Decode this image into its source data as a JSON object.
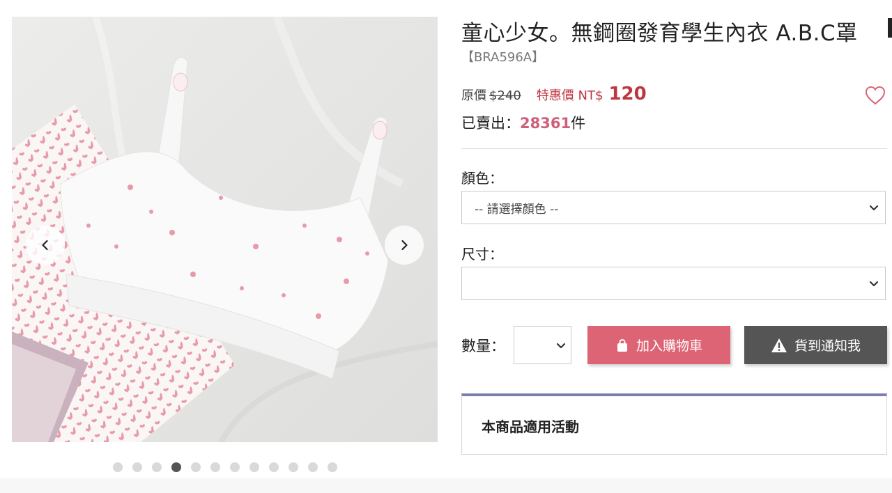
{
  "gallery": {
    "prev_icon": "chevron-left-icon",
    "next_icon": "chevron-right-icon",
    "dot_count": 12,
    "active_dot": 4,
    "accent_pink": "#e79aa8"
  },
  "product": {
    "title": "童心少女。無鋼圈發育學生內衣 A.B.C罩",
    "sku": "【BRA596A】",
    "original_price_label": "原價",
    "original_price": "$240",
    "sale_price_label": "特惠價 NT$",
    "sale_price": "120",
    "sold_label": "已賣出：",
    "sold_count": "28361",
    "sold_unit": "件",
    "wishlist_icon": "heart-outline-icon"
  },
  "options": {
    "color_label": "顏色：",
    "color_placeholder": "-- 請選擇顏色 --",
    "size_label": "尺寸：",
    "size_value": "",
    "quantity_label": "數量：",
    "quantity_value": ""
  },
  "actions": {
    "add_to_cart": "加入購物車",
    "add_to_cart_icon": "shopping-bag-icon",
    "notify": "貨到通知我",
    "notify_icon": "warning-icon"
  },
  "promo": {
    "title": "本商品適用活動"
  },
  "colors": {
    "sale_red": "#c0353f",
    "sold_pink": "#d0607a",
    "cart_button": "#dc6474",
    "notify_button": "#555555",
    "promo_border": "#7a80a8"
  }
}
